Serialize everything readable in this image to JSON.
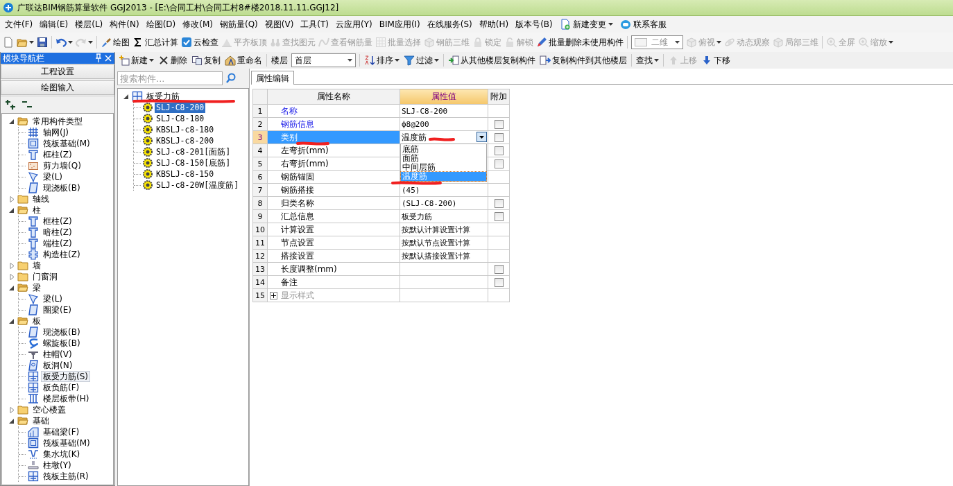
{
  "window": {
    "title": "广联达BIM钢筋算量软件 GGJ2013 - [E:\\合同工村\\合同工村8#楼2018.11.11.GGJ12]"
  },
  "menu": [
    {
      "label": "文件(F)",
      "dropdown": false
    },
    {
      "label": "编辑(E)",
      "dropdown": false
    },
    {
      "label": "楼层(L)",
      "dropdown": false
    },
    {
      "label": "构件(N)",
      "dropdown": false
    },
    {
      "label": "绘图(D)",
      "dropdown": false
    },
    {
      "label": "修改(M)",
      "dropdown": false
    },
    {
      "label": "钢筋量(Q)",
      "dropdown": false
    },
    {
      "label": "视图(V)",
      "dropdown": false
    },
    {
      "label": "工具(T)",
      "dropdown": false
    },
    {
      "label": "云应用(Y)",
      "dropdown": false
    },
    {
      "label": "BIM应用(I)",
      "dropdown": false
    },
    {
      "label": "在线服务(S)",
      "dropdown": false
    },
    {
      "label": "帮助(H)",
      "dropdown": false
    },
    {
      "label": "版本号(B)",
      "dropdown": false
    },
    {
      "label": "新建变更",
      "dropdown": true
    },
    {
      "label": "联系客服",
      "dropdown": false
    }
  ],
  "toolbar": {
    "items": [
      {
        "kind": "button",
        "disabled": false,
        "dropdown": false
      },
      {
        "kind": "button",
        "disabled": false,
        "dropdown": true
      },
      {
        "kind": "button",
        "disabled": false,
        "dropdown": false
      },
      {
        "kind": "separator"
      },
      {
        "kind": "button",
        "disabled": false,
        "dropdown": true
      },
      {
        "kind": "button",
        "disabled": true,
        "dropdown": true
      },
      {
        "kind": "separator"
      },
      {
        "kind": "button",
        "label": "绘图",
        "disabled": false,
        "dropdown": false
      },
      {
        "kind": "button",
        "label": "汇总计算",
        "disabled": false,
        "dropdown": false
      },
      {
        "kind": "button",
        "label": "云检查",
        "disabled": false,
        "dropdown": false
      },
      {
        "kind": "button",
        "label": "平齐板顶",
        "disabled": true,
        "dropdown": false
      },
      {
        "kind": "button",
        "label": "查找图元",
        "disabled": true,
        "dropdown": false
      },
      {
        "kind": "button",
        "label": "查看钢筋量",
        "disabled": true,
        "dropdown": false
      },
      {
        "kind": "button",
        "label": "批量选择",
        "disabled": true,
        "dropdown": false
      },
      {
        "kind": "button",
        "label": "钢筋三维",
        "disabled": true,
        "dropdown": false
      },
      {
        "kind": "button",
        "label": "锁定",
        "disabled": true,
        "dropdown": false
      },
      {
        "kind": "button",
        "label": "解锁",
        "disabled": true,
        "dropdown": false
      },
      {
        "kind": "button",
        "label": "批量删除未使用构件",
        "disabled": false,
        "dropdown": false
      },
      {
        "kind": "separator"
      },
      {
        "kind": "combo",
        "value": "二维",
        "disabled": true
      },
      {
        "kind": "button",
        "label": "俯视",
        "disabled": true,
        "dropdown": true
      },
      {
        "kind": "button",
        "label": "动态观察",
        "disabled": true,
        "dropdown": false
      },
      {
        "kind": "button",
        "label": "局部三维",
        "disabled": true,
        "dropdown": false
      },
      {
        "kind": "separator"
      },
      {
        "kind": "button",
        "label": "全屏",
        "disabled": true,
        "dropdown": false
      },
      {
        "kind": "button",
        "label": "缩放",
        "disabled": true,
        "dropdown": true
      }
    ]
  },
  "navigator": {
    "title": "模块导航栏",
    "buttons": [
      "工程设置",
      "绘图输入"
    ],
    "tree": [
      {
        "label": "常用构件类型",
        "expanded": true,
        "selected": false,
        "children": [
          {
            "label": "轴网(J)",
            "selected": false
          },
          {
            "label": "筏板基础(M)",
            "selected": false
          },
          {
            "label": "框柱(Z)",
            "selected": false
          },
          {
            "label": "剪力墙(Q)",
            "selected": false
          },
          {
            "label": "梁(L)",
            "selected": false
          },
          {
            "label": "现浇板(B)",
            "selected": false
          }
        ]
      },
      {
        "label": "轴线",
        "expanded": false,
        "selected": false
      },
      {
        "label": "柱",
        "expanded": true,
        "selected": false,
        "children": [
          {
            "label": "框柱(Z)",
            "selected": false
          },
          {
            "label": "暗柱(Z)",
            "selected": false
          },
          {
            "label": "端柱(Z)",
            "selected": false
          },
          {
            "label": "构造柱(Z)",
            "selected": false
          }
        ]
      },
      {
        "label": "墙",
        "expanded": false,
        "selected": false
      },
      {
        "label": "门窗洞",
        "expanded": false,
        "selected": false
      },
      {
        "label": "梁",
        "expanded": true,
        "selected": false,
        "children": [
          {
            "label": "梁(L)",
            "selected": false
          },
          {
            "label": "圈梁(E)",
            "selected": false
          }
        ]
      },
      {
        "label": "板",
        "expanded": true,
        "selected": false,
        "children": [
          {
            "label": "现浇板(B)",
            "selected": false
          },
          {
            "label": "螺旋板(B)",
            "selected": false
          },
          {
            "label": "柱帽(V)",
            "selected": false
          },
          {
            "label": "板洞(N)",
            "selected": false
          },
          {
            "label": "板受力筋(S)",
            "selected": true
          },
          {
            "label": "板负筋(F)",
            "selected": false
          },
          {
            "label": "楼层板带(H)",
            "selected": false
          }
        ]
      },
      {
        "label": "空心楼盖",
        "expanded": false,
        "selected": false
      },
      {
        "label": "基础",
        "expanded": true,
        "selected": false,
        "children": [
          {
            "label": "基础梁(F)",
            "selected": false
          },
          {
            "label": "筏板基础(M)",
            "selected": false
          },
          {
            "label": "集水坑(K)",
            "selected": false
          },
          {
            "label": "柱墩(Y)",
            "selected": false
          },
          {
            "label": "筏板主筋(R)",
            "selected": false
          }
        ]
      }
    ]
  },
  "object_toolbar": {
    "items": [
      {
        "kind": "button",
        "label": "新建",
        "disabled": false,
        "dropdown": true
      },
      {
        "kind": "button",
        "label": "删除",
        "disabled": false,
        "dropdown": false
      },
      {
        "kind": "button",
        "label": "复制",
        "disabled": false,
        "dropdown": false
      },
      {
        "kind": "button",
        "label": "重命名",
        "disabled": false,
        "dropdown": false
      },
      {
        "kind": "separator"
      },
      {
        "kind": "label",
        "label": "楼层"
      },
      {
        "kind": "combo",
        "value": "首层",
        "disabled": false
      },
      {
        "kind": "separator"
      },
      {
        "kind": "button",
        "label": "排序",
        "disabled": false,
        "dropdown": true
      },
      {
        "kind": "button",
        "label": "过滤",
        "disabled": false,
        "dropdown": true
      },
      {
        "kind": "separator"
      },
      {
        "kind": "button",
        "label": "从其他楼层复制构件",
        "disabled": false,
        "dropdown": false
      },
      {
        "kind": "button",
        "label": "复制构件到其他楼层",
        "disabled": false,
        "dropdown": false
      },
      {
        "kind": "separator"
      },
      {
        "kind": "button",
        "label": "查找",
        "disabled": false,
        "dropdown": true
      },
      {
        "kind": "separator"
      },
      {
        "kind": "button",
        "label": "上移",
        "disabled": true,
        "dropdown": false
      },
      {
        "kind": "button",
        "label": "下移",
        "disabled": false,
        "dropdown": false
      }
    ]
  },
  "components": {
    "search": {
      "placeholder": "搜索构件..."
    },
    "tree": [
      {
        "label": "板受力筋",
        "expanded": true,
        "selected": false,
        "children": [
          {
            "label": "SLJ-C8-200",
            "selected": true
          },
          {
            "label": "SLJ-C8-180",
            "selected": false
          },
          {
            "label": "KBSLJ-c8-180",
            "selected": false
          },
          {
            "label": "KBSLJ-c8-200",
            "selected": false
          },
          {
            "label": "SLJ-c8-201[面筋]",
            "selected": false
          },
          {
            "label": "SLJ-C8-150[底筋]",
            "selected": false
          },
          {
            "label": "KBSLJ-c8-150",
            "selected": false
          },
          {
            "label": "SLJ-c8-20W[温度筋]",
            "selected": false
          }
        ]
      }
    ]
  },
  "properties": {
    "tabs": [
      {
        "label": "属性编辑",
        "selected": true
      }
    ],
    "columns": [
      "属性名称",
      "属性值",
      "附加"
    ],
    "rows": [
      {
        "num": "1",
        "name": "名称",
        "value": "SLJ-C8-200",
        "link": true,
        "selected": false
      },
      {
        "num": "2",
        "name": "钢筋信息",
        "value": "ф8@200",
        "link": true,
        "selected": false,
        "addon": {
          "checked": false
        }
      },
      {
        "num": "3",
        "name": "类别",
        "value": "温度筋",
        "link": false,
        "selected": true,
        "addon": {
          "checked": false
        },
        "editor": {
          "options": [
            {
              "label": "底筋",
              "selected": false
            },
            {
              "label": "面筋",
              "selected": false
            },
            {
              "label": "中间层筋",
              "selected": false
            },
            {
              "label": "温度筋",
              "selected": true
            }
          ]
        }
      },
      {
        "num": "4",
        "name": "左弯折(mm)",
        "link": false,
        "selected": false,
        "addon": {
          "checked": false
        }
      },
      {
        "num": "5",
        "name": "右弯折(mm)",
        "link": false,
        "selected": false,
        "addon": {
          "checked": false
        }
      },
      {
        "num": "6",
        "name": "钢筋锚固",
        "link": false,
        "selected": false
      },
      {
        "num": "7",
        "name": "钢筋搭接",
        "value": "(45)",
        "link": false,
        "selected": false
      },
      {
        "num": "8",
        "name": "归类名称",
        "value": "(SLJ-C8-200)",
        "link": false,
        "selected": false,
        "addon": {
          "checked": false
        }
      },
      {
        "num": "9",
        "name": "汇总信息",
        "value": "板受力筋",
        "link": false,
        "selected": false,
        "addon": {
          "checked": false
        }
      },
      {
        "num": "10",
        "name": "计算设置",
        "value": "按默认计算设置计算",
        "link": false,
        "selected": false
      },
      {
        "num": "11",
        "name": "节点设置",
        "value": "按默认节点设置计算",
        "link": false,
        "selected": false
      },
      {
        "num": "12",
        "name": "搭接设置",
        "value": "按默认搭接设置计算",
        "link": false,
        "selected": false
      },
      {
        "num": "13",
        "name": "长度调整(mm)",
        "link": false,
        "selected": false,
        "addon": {
          "checked": false
        }
      },
      {
        "num": "14",
        "name": "备注",
        "link": false,
        "selected": false,
        "addon": {
          "checked": false
        }
      },
      {
        "num": "15",
        "name": "显示样式",
        "link": false,
        "selected": false,
        "disabled": true,
        "expanded": false
      }
    ]
  }
}
